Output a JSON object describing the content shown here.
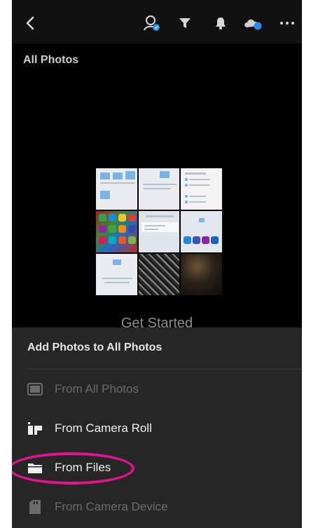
{
  "app": {
    "album_title": "All Photos",
    "empty_state": "Get Started"
  },
  "toolbar": {
    "back_icon": "chevron-left-icon",
    "search_icon": "person-search-icon",
    "filter_icon": "filter-icon",
    "notifications_icon": "bell-icon",
    "cloud_icon": "cloud-sync-icon",
    "more_icon": "more-horizontal-icon"
  },
  "sheet": {
    "title": "Add Photos to All Photos",
    "items": [
      {
        "label": "From All Photos",
        "icon": "photo-icon",
        "enabled": false
      },
      {
        "label": "From Camera Roll",
        "icon": "camera-roll-icon",
        "enabled": true
      },
      {
        "label": "From Files",
        "icon": "folder-icon",
        "enabled": true
      },
      {
        "label": "From Camera Device",
        "icon": "sd-card-icon",
        "enabled": false
      }
    ]
  },
  "colors": {
    "highlight": "#e0148e",
    "accent_blue": "#2d8ceb",
    "sheet_background": "#262626"
  }
}
